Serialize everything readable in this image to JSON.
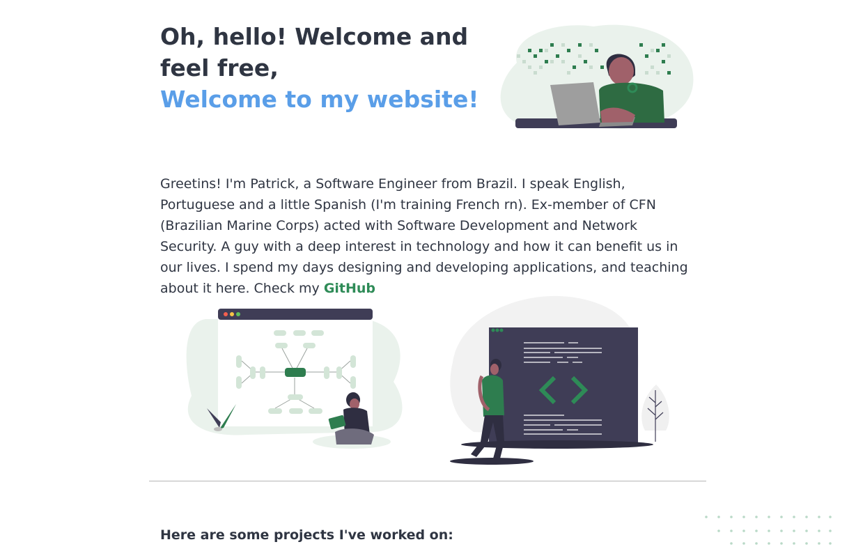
{
  "hero": {
    "title_line": "Oh, hello! Welcome and feel free,",
    "title_accent": "Welcome to my website!"
  },
  "intro": {
    "text": "Greetins! I'm Patrick, a Software Engineer from Brazil. I speak English, Portuguese and a little Spanish (I'm training French rn). Ex-member of CFN (Brazilian Marine Corps) acted with Software Development and Network Security. A guy with a deep interest in technology and how it can benefit us in our lives. I spend my days designing and developing applications, and teaching about it here. Check my ",
    "link_label": "GitHub"
  },
  "projects": {
    "heading": "Here are some projects I've worked on:"
  },
  "colors": {
    "title": "#2f3542",
    "accent": "#5a9ee8",
    "link": "#2e8b57",
    "illustration_green": "#2e7d4f",
    "illustration_dark": "#3f3d56"
  },
  "illustrations": [
    "person-with-laptop-illustration",
    "mind-map-illustration",
    "code-window-illustration"
  ]
}
